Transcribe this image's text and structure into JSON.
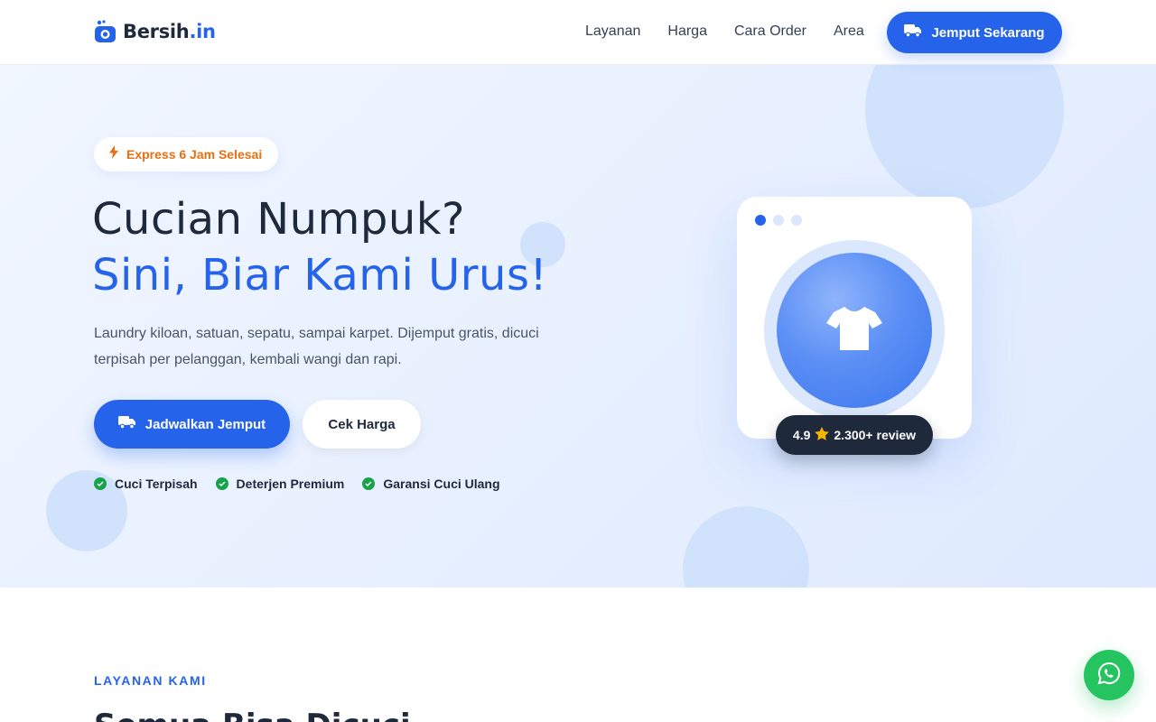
{
  "nav": {
    "logo": {
      "name": "Bersih",
      "tld": ".in"
    },
    "links": [
      "Layanan",
      "Harga",
      "Cara Order",
      "Area"
    ],
    "cta_label": "Jemput Sekarang"
  },
  "hero": {
    "badge": "Express 6 Jam Selesai",
    "title_line1": "Cucian Numpuk?",
    "title_line2": "Sini, Biar Kami Urus!",
    "description": "Laundry kiloan, satuan, sepatu, sampai karpet. Dijemput gratis, dicuci terpisah per pelanggan, kembali wangi dan rapi.",
    "primary_cta": "Jadwalkan Jemput",
    "secondary_cta": "Cek Harga",
    "features": [
      "Cuci Terpisah",
      "Deterjen Premium",
      "Garansi Cuci Ulang"
    ],
    "card": {
      "rating_value": "4.9",
      "review_count": "2.300+ review"
    }
  },
  "services": {
    "label": "LAYANAN KAMI",
    "title": "Semua Bisa Dicuci"
  },
  "icons": {
    "logo": "washer-icon",
    "truck": "truck-icon",
    "bolt": "lightning-bolt-icon",
    "check": "check-circle-icon",
    "shirt": "t-shirt-icon",
    "star": "star-icon",
    "whatsapp": "whatsapp-icon"
  },
  "colors": {
    "primary": "#2563eb",
    "accent_orange": "#ea6f12",
    "dark": "#1e293b",
    "success": "#16a34a",
    "whatsapp": "#25c460",
    "star": "#f5b400"
  }
}
